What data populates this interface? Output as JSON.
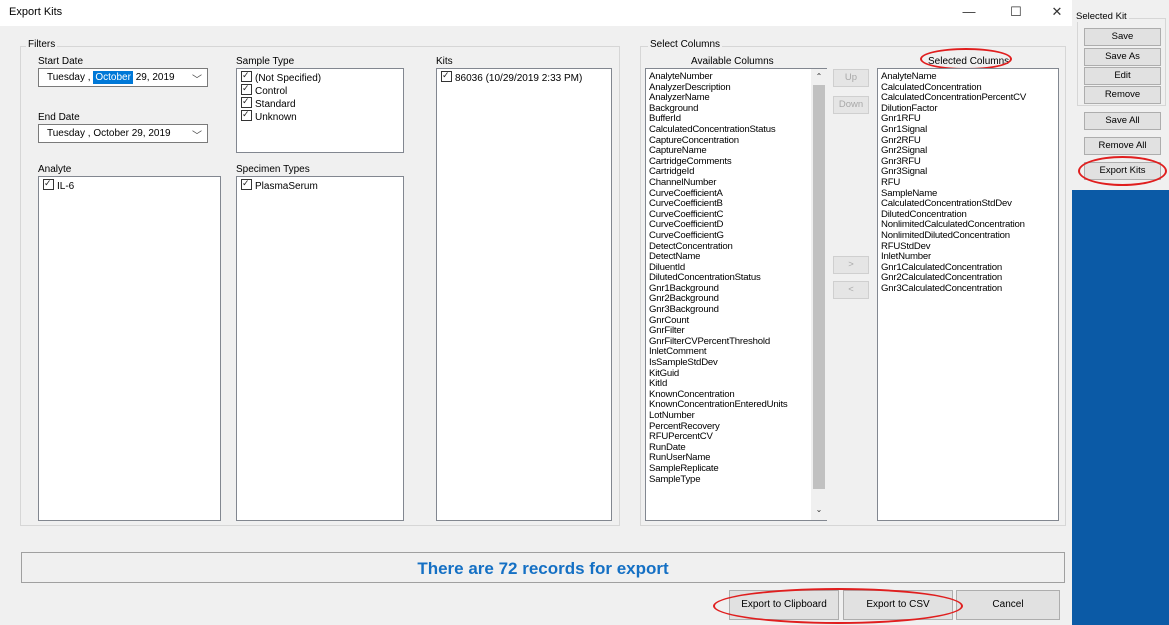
{
  "window": {
    "title": "Export Kits",
    "controls": {
      "minimize": "—",
      "maximize": "☐",
      "close": "✕"
    }
  },
  "filters": {
    "group_label": "Filters",
    "start_date": {
      "label": "Start Date",
      "day": "Tuesday",
      "sep": ",",
      "month": "October",
      "date_year": "29, 2019"
    },
    "end_date": {
      "label": "End Date",
      "day": "Tuesday",
      "sep": ",",
      "month": "October",
      "date_year": "29, 2019"
    },
    "sample_type": {
      "label": "Sample Type",
      "items": [
        "(Not Specified)",
        "Control",
        "Standard",
        "Unknown"
      ]
    },
    "analyte": {
      "label": "Analyte",
      "items": [
        "IL-6"
      ]
    },
    "specimen_types": {
      "label": "Specimen Types",
      "items": [
        "PlasmaSerum"
      ]
    },
    "kits": {
      "label": "Kits",
      "items": [
        "86036 (10/29/2019 2:33 PM)"
      ]
    }
  },
  "columns": {
    "group_label": "Select Columns",
    "available_label": "Available Columns",
    "selected_label": "Selected Columns",
    "available": [
      "AnalyteNumber",
      "AnalyzerDescription",
      "AnalyzerName",
      "Background",
      "BufferId",
      "CalculatedConcentrationStatus",
      "CaptureConcentration",
      "CaptureName",
      "CartridgeComments",
      "CartridgeId",
      "ChannelNumber",
      "CurveCoefficientA",
      "CurveCoefficientB",
      "CurveCoefficientC",
      "CurveCoefficientD",
      "CurveCoefficientG",
      "DetectConcentration",
      "DetectName",
      "DiluentId",
      "DilutedConcentrationStatus",
      "Gnr1Background",
      "Gnr2Background",
      "Gnr3Background",
      "GnrCount",
      "GnrFilter",
      "GnrFilterCVPercentThreshold",
      "InletComment",
      "IsSampleStdDev",
      "KitGuid",
      "KitId",
      "KnownConcentration",
      "KnownConcentrationEnteredUnits",
      "LotNumber",
      "PercentRecovery",
      "RFUPercentCV",
      "RunDate",
      "RunUserName",
      "SampleReplicate",
      "SampleType"
    ],
    "selected": [
      "AnalyteName",
      "CalculatedConcentration",
      "CalculatedConcentrationPercentCV",
      "DilutionFactor",
      "Gnr1RFU",
      "Gnr1Signal",
      "Gnr2RFU",
      "Gnr2Signal",
      "Gnr3RFU",
      "Gnr3Signal",
      "RFU",
      "SampleName",
      "CalculatedConcentrationStdDev",
      "DilutedConcentration",
      "NonlimitedCalculatedConcentration",
      "NonlimitedDilutedConcentration",
      "RFUStdDev",
      "InletNumber",
      "Gnr1CalculatedConcentration",
      "Gnr2CalculatedConcentration",
      "Gnr3CalculatedConcentration"
    ],
    "buttons": {
      "up": "Up",
      "down": "Down",
      "add": ">",
      "remove": "<"
    }
  },
  "message": "There are 72 records for export",
  "footer": {
    "clipboard": "Export to Clipboard",
    "csv": "Export to CSV",
    "cancel": "Cancel"
  },
  "side_panel": {
    "group_label": "Selected Kit",
    "save": "Save",
    "save_as": "Save As",
    "edit": "Edit",
    "remove": "Remove",
    "save_all": "Save All",
    "remove_all": "Remove All",
    "export_kits": "Export Kits"
  },
  "colors": {
    "accent": "#0078d7",
    "message": "#1570c4",
    "highlight": "#e01e1e",
    "desktop": "#0b5aa6"
  }
}
